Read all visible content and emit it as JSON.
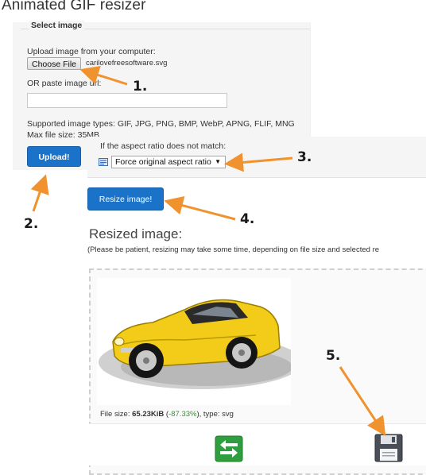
{
  "page": {
    "title": "Animated GIF resizer"
  },
  "upload": {
    "legend": "Select image",
    "upload_label": "Upload image from your computer:",
    "choose_file_label": "Choose File",
    "chosen_filename": "carilovefreesoftware.svg",
    "url_label": "OR paste image url:",
    "url_value": "",
    "supported_types": "Supported image types: GIF, JPG, PNG, BMP, WebP, APNG, FLIF, MNG",
    "max_size": "Max file size: 35MB",
    "upload_button": "Upload!"
  },
  "aspect": {
    "label": "If the aspect ratio does not match:",
    "selected_option": "Force original aspect ratio",
    "caret": "▼"
  },
  "resize": {
    "button_label": "Resize image!"
  },
  "result": {
    "heading": "Resized image:",
    "note": "(Please be patient, resizing may take some time, depending on file size and selected re",
    "file_size_prefix": "File size: ",
    "file_size_value": "65.23KiB",
    "open_paren": " (",
    "file_size_change": "-87.33%",
    "file_type_suffix": "), type: svg"
  },
  "annotations": {
    "step_1": "1.",
    "step_2": "2.",
    "step_3": "3.",
    "step_4": "4.",
    "step_5": "5.",
    "arrow_color": "#f0922e"
  },
  "icons": {
    "swap": "swap-arrows-icon",
    "save": "floppy-disk-save-icon",
    "select": "list-select-icon"
  },
  "colors": {
    "primary_button": "#1a73c8",
    "panel_background": "#f5f5f5",
    "percent_change": "#3c8c3c",
    "car_body": "#f2cc18"
  }
}
